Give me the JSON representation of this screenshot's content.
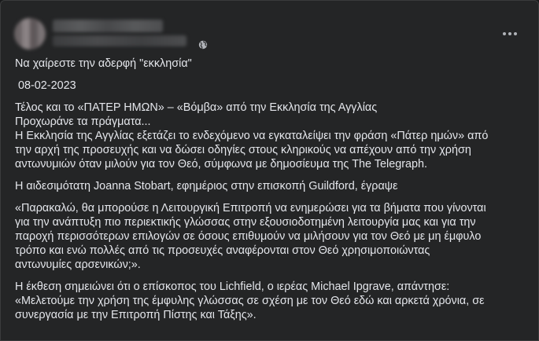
{
  "post": {
    "globe_icon": "globe-icon",
    "more_icon": "more-horizontal-icon",
    "group_line": "Να χαίρεστε την αδερφή \"εκκλησία\"",
    "date_line": " 08-02-2023",
    "para1": [
      "Τέλος και το «ΠΑΤΕΡ ΗΜΩΝ» – «Βόμβα» από την Εκκλησία της Αγγλίας",
      "Προχωράνε τα πράγματα...",
      "Η Εκκλησία της Αγγλίας εξετάζει το ενδεχόμενο να εγκαταλείψει την φράση «Πάτερ ημών» από",
      "την αρχή της προσευχής και να δώσει οδηγίες στους κληρικούς να απέχουν από την χρήση",
      "αντωνυμιών όταν μιλούν για τον Θεό, σύμφωνα με δημοσίευμα της The Telegraph."
    ],
    "para2": [
      "Η αιδεσιμότατη Joanna Stobart, εφημέριος στην επισκοπή Guildford, έγραψε"
    ],
    "para3": [
      "«Παρακαλώ, θα μπορούσε η Λειτουργική Επιτροπή να ενημερώσει για τα βήματα που γίνονται",
      "για την ανάπτυξη πιο περιεκτικής γλώσσας στην εξουσιοδοτημένη λειτουργία μας και για την",
      "παροχή περισσότερων επιλογών σε όσους επιθυμούν να μιλήσουν για τον Θεό με μη έμφυλο",
      "τρόπο και ενώ πολλές από τις προσευχές αναφέρονται στον Θεό χρησιμοποιώντας",
      "αντωνυμίες αρσενικών;»."
    ],
    "para4": [
      "Η έκθεση σημειώνει ότι ο επίσκοπος του Lichfield, ο ιερέας Michael Ipgrave, απάντησε:",
      "«Μελετούμε την χρήση της έμφυλης γλώσσας σε σχέση με τον Θεό εδώ και αρκετά χρόνια, σε",
      "συνεργασία με την Επιτροπή Πίστης και Τάξης»."
    ]
  },
  "colors": {
    "background": "#242526",
    "text": "#e4e6eb",
    "secondary": "#b0b3b8"
  }
}
